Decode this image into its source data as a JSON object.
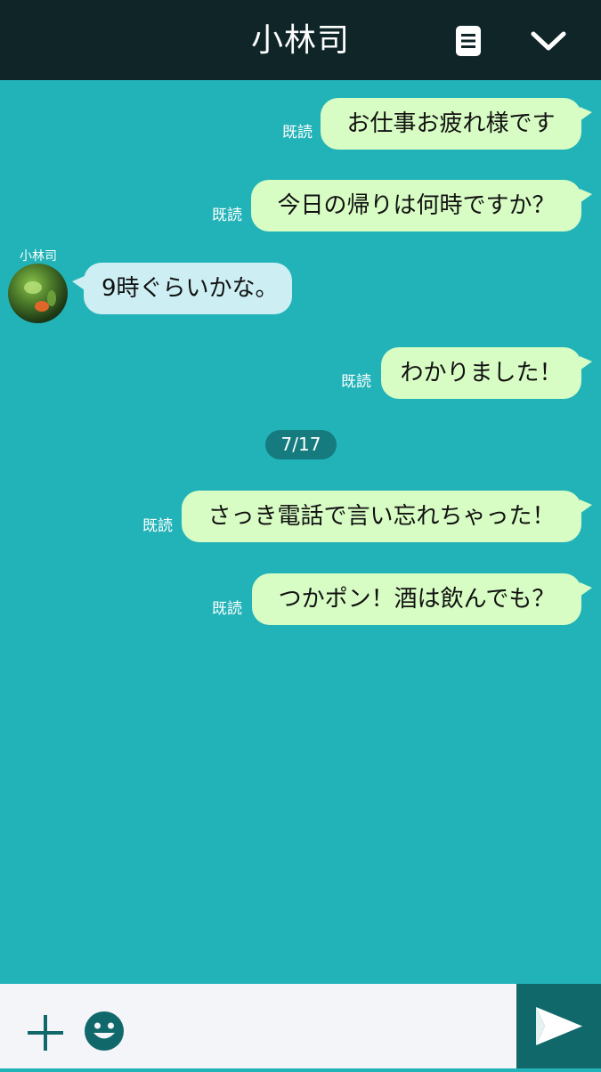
{
  "header": {
    "title": "小林司",
    "memo_icon": "memo-icon",
    "collapse_icon": "chevron-down-icon"
  },
  "chat": {
    "sender_name": "小林司",
    "read_label": "既読",
    "date_separator": "7/17",
    "messages": [
      {
        "direction": "out",
        "text": "お仕事お疲れ様です",
        "read": "既読"
      },
      {
        "direction": "out",
        "text": "今日の帰りは何時ですか？",
        "read": "既読"
      },
      {
        "direction": "in",
        "text": "9時ぐらいかな。",
        "sender": "小林司"
      },
      {
        "direction": "out",
        "text": "わかりました！",
        "read": "既読"
      },
      {
        "direction": "out",
        "text": "さっき電話で言い忘れちゃった！",
        "read": "既読"
      },
      {
        "direction": "out",
        "text": "つかポン！酒は飲んでも？",
        "read": "既読"
      }
    ]
  },
  "input_bar": {
    "message_value": "",
    "message_placeholder": "",
    "plus_icon": "plus-icon",
    "emoji_icon": "emoji-icon",
    "send_icon": "send-icon"
  },
  "colors": {
    "header_bg": "#0f2528",
    "chat_bg": "#22b3b8",
    "outgoing_bubble": "#d8fdc4",
    "incoming_bubble": "#cdeff4",
    "date_chip": "#167b7f",
    "send_button": "#11686b",
    "input_bar_bg": "#f3f5f8"
  }
}
